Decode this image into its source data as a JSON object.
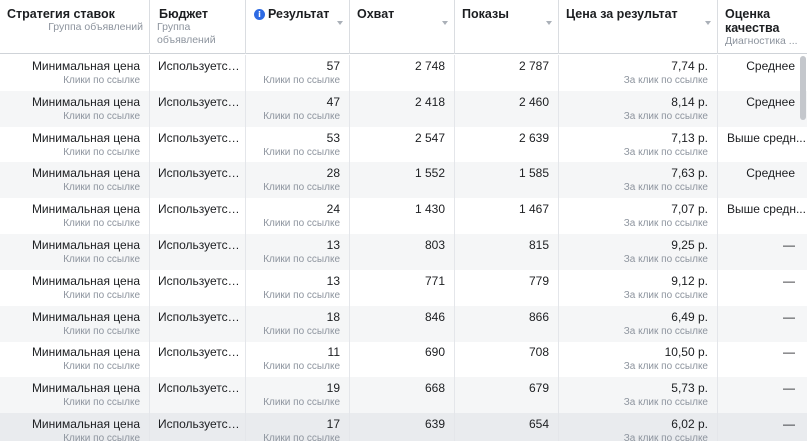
{
  "columns": [
    {
      "title": "Стратегия ставок",
      "sub": "Группа объявлений"
    },
    {
      "title": "Бюджет",
      "sub": "Группа объявлений"
    },
    {
      "title": "Результат",
      "sub": ""
    },
    {
      "title": "Охват",
      "sub": ""
    },
    {
      "title": "Показы",
      "sub": ""
    },
    {
      "title": "Цена за результат",
      "sub": ""
    },
    {
      "title": "Оценка качества",
      "sub": "Диагностика ..."
    }
  ],
  "rows": [
    {
      "strategy": "Минимальная цена",
      "strategy_sub": "Клики по ссылке",
      "budget": "Используется ...",
      "result": "57",
      "result_sub": "Клики по ссылке",
      "reach": "2 748",
      "impressions": "2 787",
      "cost": "7,74 р.",
      "cost_sub": "За клик по ссылке",
      "quality": "Среднее"
    },
    {
      "strategy": "Минимальная цена",
      "strategy_sub": "Клики по ссылке",
      "budget": "Используется ...",
      "result": "47",
      "result_sub": "Клики по ссылке",
      "reach": "2 418",
      "impressions": "2 460",
      "cost": "8,14 р.",
      "cost_sub": "За клик по ссылке",
      "quality": "Среднее"
    },
    {
      "strategy": "Минимальная цена",
      "strategy_sub": "Клики по ссылке",
      "budget": "Используется ...",
      "result": "53",
      "result_sub": "Клики по ссылке",
      "reach": "2 547",
      "impressions": "2 639",
      "cost": "7,13 р.",
      "cost_sub": "За клик по ссылке",
      "quality": "Выше средн..."
    },
    {
      "strategy": "Минимальная цена",
      "strategy_sub": "Клики по ссылке",
      "budget": "Используется ...",
      "result": "28",
      "result_sub": "Клики по ссылке",
      "reach": "1 552",
      "impressions": "1 585",
      "cost": "7,63 р.",
      "cost_sub": "За клик по ссылке",
      "quality": "Среднее"
    },
    {
      "strategy": "Минимальная цена",
      "strategy_sub": "Клики по ссылке",
      "budget": "Используется ...",
      "result": "24",
      "result_sub": "Клики по ссылке",
      "reach": "1 430",
      "impressions": "1 467",
      "cost": "7,07 р.",
      "cost_sub": "За клик по ссылке",
      "quality": "Выше средн..."
    },
    {
      "strategy": "Минимальная цена",
      "strategy_sub": "Клики по ссылке",
      "budget": "Используется ...",
      "result": "13",
      "result_sub": "Клики по ссылке",
      "reach": "803",
      "impressions": "815",
      "cost": "9,25 р.",
      "cost_sub": "За клик по ссылке",
      "quality": "—"
    },
    {
      "strategy": "Минимальная цена",
      "strategy_sub": "Клики по ссылке",
      "budget": "Используется ...",
      "result": "13",
      "result_sub": "Клики по ссылке",
      "reach": "771",
      "impressions": "779",
      "cost": "9,12 р.",
      "cost_sub": "За клик по ссылке",
      "quality": "—"
    },
    {
      "strategy": "Минимальная цена",
      "strategy_sub": "Клики по ссылке",
      "budget": "Используется ...",
      "result": "18",
      "result_sub": "Клики по ссылке",
      "reach": "846",
      "impressions": "866",
      "cost": "6,49 р.",
      "cost_sub": "За клик по ссылке",
      "quality": "—"
    },
    {
      "strategy": "Минимальная цена",
      "strategy_sub": "Клики по ссылке",
      "budget": "Используется ...",
      "result": "11",
      "result_sub": "Клики по ссылке",
      "reach": "690",
      "impressions": "708",
      "cost": "10,50 р.",
      "cost_sub": "За клик по ссылке",
      "quality": "—"
    },
    {
      "strategy": "Минимальная цена",
      "strategy_sub": "Клики по ссылке",
      "budget": "Используется ...",
      "result": "19",
      "result_sub": "Клики по ссылке",
      "reach": "668",
      "impressions": "679",
      "cost": "5,73 р.",
      "cost_sub": "За клик по ссылке",
      "quality": "—"
    },
    {
      "strategy": "Минимальная цена",
      "strategy_sub": "Клики по ссылке",
      "budget": "Используется ...",
      "result": "17",
      "result_sub": "Клики по ссылке",
      "reach": "639",
      "impressions": "654",
      "cost": "6,02 р.",
      "cost_sub": "За клик по ссылке",
      "quality": "—"
    }
  ]
}
